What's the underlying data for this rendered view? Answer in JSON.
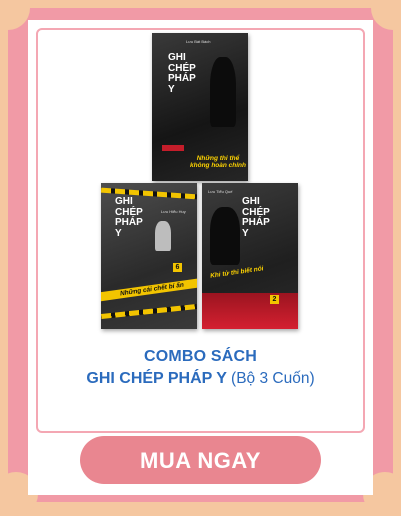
{
  "books": [
    {
      "author": "Lưu Bát Bách",
      "title_line1": "GHI",
      "title_line2": "CHÉP",
      "title_line3": "PHÁP",
      "title_line4": "Y",
      "subtitle": "Những thi thể không hoàn chỉnh",
      "volume": ""
    },
    {
      "author": "Lưu Hiểu Huy",
      "title_line1": "GHI",
      "title_line2": "CHÉP",
      "title_line3": "PHÁP",
      "title_line4": "Y",
      "subtitle": "Những cái chết bí ẩn",
      "volume": "6"
    },
    {
      "author": "Lưu Tiểu Quế",
      "title_line1": "GHI",
      "title_line2": "CHÉP",
      "title_line3": "PHÁP",
      "title_line4": "Y",
      "subtitle": "Khi tử thi biết nói",
      "volume": "2"
    }
  ],
  "headline": {
    "line1": "COMBO SÁCH",
    "line2_main": "GHI CHÉP PHÁP Y",
    "line2_suffix": "(Bộ 3 Cuốn)"
  },
  "cta": {
    "label": "MUA NGAY"
  },
  "colors": {
    "frame": "#f19aa6",
    "background": "#f5c7a0",
    "headline": "#2b6bbd",
    "button": "#e98690"
  }
}
